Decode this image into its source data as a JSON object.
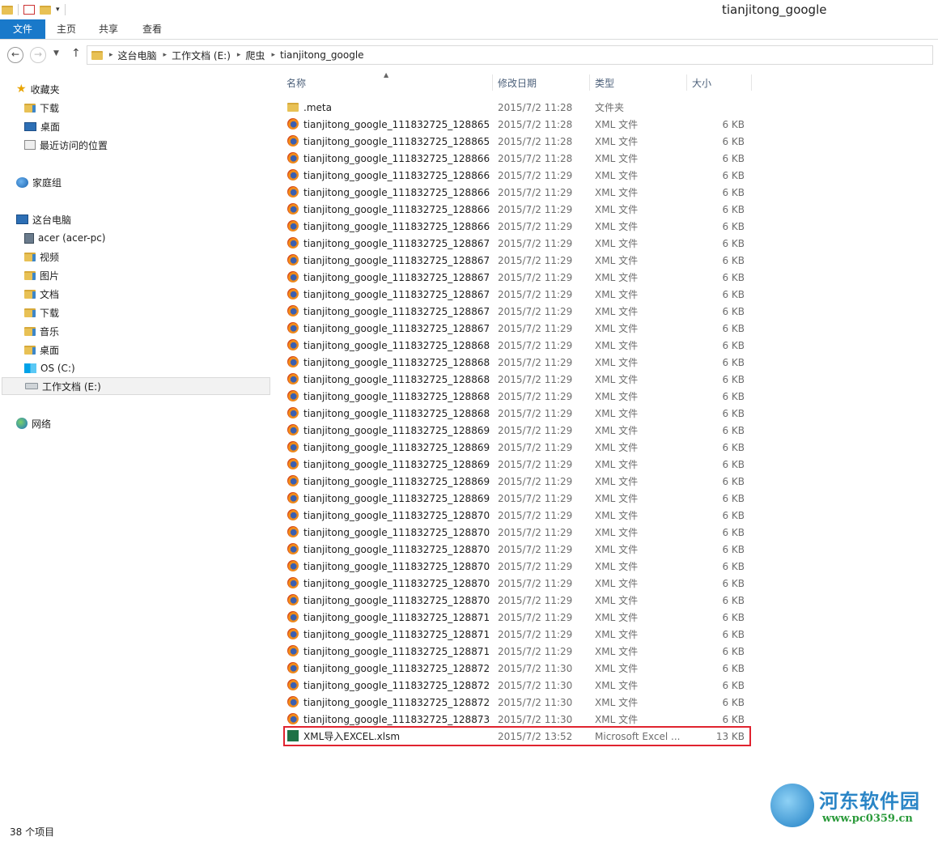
{
  "window": {
    "title": "tianjitong_google"
  },
  "ribbon": {
    "tabs": [
      "文件",
      "主页",
      "共享",
      "查看"
    ]
  },
  "address": {
    "breadcrumbs": [
      "这台电脑",
      "工作文档 (E:)",
      "爬虫",
      "tianjitong_google"
    ]
  },
  "nav": {
    "favorites": {
      "label": "收藏夹",
      "items": [
        "下载",
        "桌面",
        "最近访问的位置"
      ]
    },
    "homegroup": "家庭组",
    "thispc": {
      "label": "这台电脑",
      "items": [
        "acer (acer-pc)",
        "视频",
        "图片",
        "文档",
        "下载",
        "音乐",
        "桌面",
        "OS (C:)",
        "工作文档 (E:)"
      ]
    },
    "network": "网络"
  },
  "columns": {
    "name": "名称",
    "date": "修改日期",
    "type": "类型",
    "size": "大小"
  },
  "files": [
    {
      "name": ".meta",
      "date": "2015/7/2 11:28",
      "type": "文件夹",
      "size": "",
      "icon": "folder-icon"
    },
    {
      "name": "tianjitong_google_111832725_128865...",
      "date": "2015/7/2 11:28",
      "type": "XML 文件",
      "size": "6 KB",
      "icon": "firefox-icon"
    },
    {
      "name": "tianjitong_google_111832725_128865...",
      "date": "2015/7/2 11:28",
      "type": "XML 文件",
      "size": "6 KB",
      "icon": "firefox-icon"
    },
    {
      "name": "tianjitong_google_111832725_128866...",
      "date": "2015/7/2 11:28",
      "type": "XML 文件",
      "size": "6 KB",
      "icon": "firefox-icon"
    },
    {
      "name": "tianjitong_google_111832725_128866...",
      "date": "2015/7/2 11:29",
      "type": "XML 文件",
      "size": "6 KB",
      "icon": "firefox-icon"
    },
    {
      "name": "tianjitong_google_111832725_128866...",
      "date": "2015/7/2 11:29",
      "type": "XML 文件",
      "size": "6 KB",
      "icon": "firefox-icon"
    },
    {
      "name": "tianjitong_google_111832725_128866...",
      "date": "2015/7/2 11:29",
      "type": "XML 文件",
      "size": "6 KB",
      "icon": "firefox-icon"
    },
    {
      "name": "tianjitong_google_111832725_128866...",
      "date": "2015/7/2 11:29",
      "type": "XML 文件",
      "size": "6 KB",
      "icon": "firefox-icon"
    },
    {
      "name": "tianjitong_google_111832725_128867...",
      "date": "2015/7/2 11:29",
      "type": "XML 文件",
      "size": "6 KB",
      "icon": "firefox-icon"
    },
    {
      "name": "tianjitong_google_111832725_128867...",
      "date": "2015/7/2 11:29",
      "type": "XML 文件",
      "size": "6 KB",
      "icon": "firefox-icon"
    },
    {
      "name": "tianjitong_google_111832725_128867...",
      "date": "2015/7/2 11:29",
      "type": "XML 文件",
      "size": "6 KB",
      "icon": "firefox-icon"
    },
    {
      "name": "tianjitong_google_111832725_128867...",
      "date": "2015/7/2 11:29",
      "type": "XML 文件",
      "size": "6 KB",
      "icon": "firefox-icon"
    },
    {
      "name": "tianjitong_google_111832725_128867...",
      "date": "2015/7/2 11:29",
      "type": "XML 文件",
      "size": "6 KB",
      "icon": "firefox-icon"
    },
    {
      "name": "tianjitong_google_111832725_128867...",
      "date": "2015/7/2 11:29",
      "type": "XML 文件",
      "size": "6 KB",
      "icon": "firefox-icon"
    },
    {
      "name": "tianjitong_google_111832725_128868...",
      "date": "2015/7/2 11:29",
      "type": "XML 文件",
      "size": "6 KB",
      "icon": "firefox-icon"
    },
    {
      "name": "tianjitong_google_111832725_128868...",
      "date": "2015/7/2 11:29",
      "type": "XML 文件",
      "size": "6 KB",
      "icon": "firefox-icon"
    },
    {
      "name": "tianjitong_google_111832725_128868...",
      "date": "2015/7/2 11:29",
      "type": "XML 文件",
      "size": "6 KB",
      "icon": "firefox-icon"
    },
    {
      "name": "tianjitong_google_111832725_128868...",
      "date": "2015/7/2 11:29",
      "type": "XML 文件",
      "size": "6 KB",
      "icon": "firefox-icon"
    },
    {
      "name": "tianjitong_google_111832725_128868...",
      "date": "2015/7/2 11:29",
      "type": "XML 文件",
      "size": "6 KB",
      "icon": "firefox-icon"
    },
    {
      "name": "tianjitong_google_111832725_128869...",
      "date": "2015/7/2 11:29",
      "type": "XML 文件",
      "size": "6 KB",
      "icon": "firefox-icon"
    },
    {
      "name": "tianjitong_google_111832725_128869...",
      "date": "2015/7/2 11:29",
      "type": "XML 文件",
      "size": "6 KB",
      "icon": "firefox-icon"
    },
    {
      "name": "tianjitong_google_111832725_128869...",
      "date": "2015/7/2 11:29",
      "type": "XML 文件",
      "size": "6 KB",
      "icon": "firefox-icon"
    },
    {
      "name": "tianjitong_google_111832725_128869...",
      "date": "2015/7/2 11:29",
      "type": "XML 文件",
      "size": "6 KB",
      "icon": "firefox-icon"
    },
    {
      "name": "tianjitong_google_111832725_128869...",
      "date": "2015/7/2 11:29",
      "type": "XML 文件",
      "size": "6 KB",
      "icon": "firefox-icon"
    },
    {
      "name": "tianjitong_google_111832725_128870...",
      "date": "2015/7/2 11:29",
      "type": "XML 文件",
      "size": "6 KB",
      "icon": "firefox-icon"
    },
    {
      "name": "tianjitong_google_111832725_128870...",
      "date": "2015/7/2 11:29",
      "type": "XML 文件",
      "size": "6 KB",
      "icon": "firefox-icon"
    },
    {
      "name": "tianjitong_google_111832725_128870...",
      "date": "2015/7/2 11:29",
      "type": "XML 文件",
      "size": "6 KB",
      "icon": "firefox-icon"
    },
    {
      "name": "tianjitong_google_111832725_128870...",
      "date": "2015/7/2 11:29",
      "type": "XML 文件",
      "size": "6 KB",
      "icon": "firefox-icon"
    },
    {
      "name": "tianjitong_google_111832725_128870...",
      "date": "2015/7/2 11:29",
      "type": "XML 文件",
      "size": "6 KB",
      "icon": "firefox-icon"
    },
    {
      "name": "tianjitong_google_111832725_128870...",
      "date": "2015/7/2 11:29",
      "type": "XML 文件",
      "size": "6 KB",
      "icon": "firefox-icon"
    },
    {
      "name": "tianjitong_google_111832725_128871...",
      "date": "2015/7/2 11:29",
      "type": "XML 文件",
      "size": "6 KB",
      "icon": "firefox-icon"
    },
    {
      "name": "tianjitong_google_111832725_128871...",
      "date": "2015/7/2 11:29",
      "type": "XML 文件",
      "size": "6 KB",
      "icon": "firefox-icon"
    },
    {
      "name": "tianjitong_google_111832725_128871...",
      "date": "2015/7/2 11:29",
      "type": "XML 文件",
      "size": "6 KB",
      "icon": "firefox-icon"
    },
    {
      "name": "tianjitong_google_111832725_128872...",
      "date": "2015/7/2 11:30",
      "type": "XML 文件",
      "size": "6 KB",
      "icon": "firefox-icon"
    },
    {
      "name": "tianjitong_google_111832725_128872...",
      "date": "2015/7/2 11:30",
      "type": "XML 文件",
      "size": "6 KB",
      "icon": "firefox-icon"
    },
    {
      "name": "tianjitong_google_111832725_128872...",
      "date": "2015/7/2 11:30",
      "type": "XML 文件",
      "size": "6 KB",
      "icon": "firefox-icon"
    },
    {
      "name": "tianjitong_google_111832725_128873...",
      "date": "2015/7/2 11:30",
      "type": "XML 文件",
      "size": "6 KB",
      "icon": "firefox-icon"
    },
    {
      "name": "XML导入EXCEL.xlsm",
      "date": "2015/7/2 13:52",
      "type": "Microsoft Excel ...",
      "size": "13 KB",
      "icon": "excel-icon",
      "highlighted": true
    }
  ],
  "status": {
    "item_count": "38 个项目"
  },
  "watermark": {
    "title": "河东软件园",
    "url": "www.pc0359.cn"
  },
  "colors": {
    "accent": "#1979ca",
    "highlight": "#e0232f"
  }
}
